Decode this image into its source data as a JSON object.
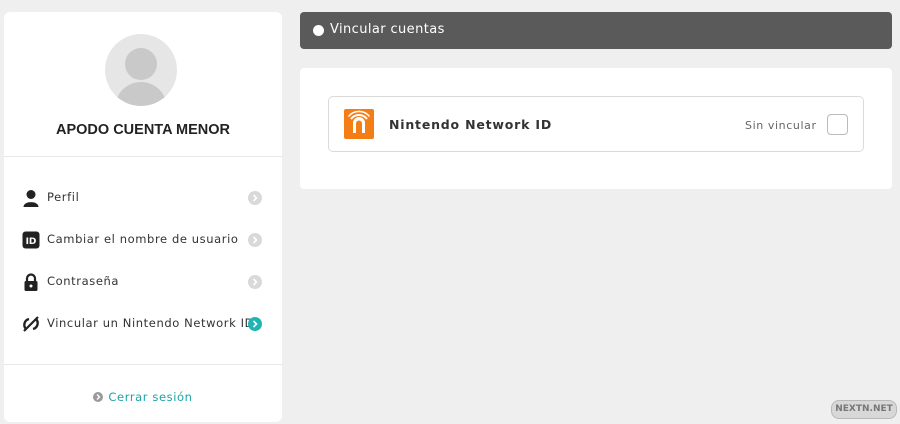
{
  "profile": {
    "nickname": "APODO CUENTA MENOR"
  },
  "sidebar": {
    "items": [
      {
        "label": "Perfil",
        "icon": "person-icon",
        "active": false
      },
      {
        "label": "Cambiar el nombre de usuario",
        "icon": "id-icon",
        "active": false
      },
      {
        "label": "Contraseña",
        "icon": "lock-icon",
        "active": false
      },
      {
        "label": "Vincular un Nintendo Network ID",
        "icon": "link-icon",
        "active": true
      }
    ],
    "logout_label": "Cerrar sesión"
  },
  "header": {
    "title": "Vincular cuentas"
  },
  "accounts": [
    {
      "name": "Nintendo Network ID",
      "status": "Sin vincular",
      "icon": "nintendo-network-logo",
      "linked": false
    }
  ],
  "watermark": "NEXTN.NET",
  "colors": {
    "accent": "#1fb5b5",
    "header_bg": "#5a5a5a",
    "nnid_orange": "#f57d16",
    "page_bg": "#efefef"
  }
}
